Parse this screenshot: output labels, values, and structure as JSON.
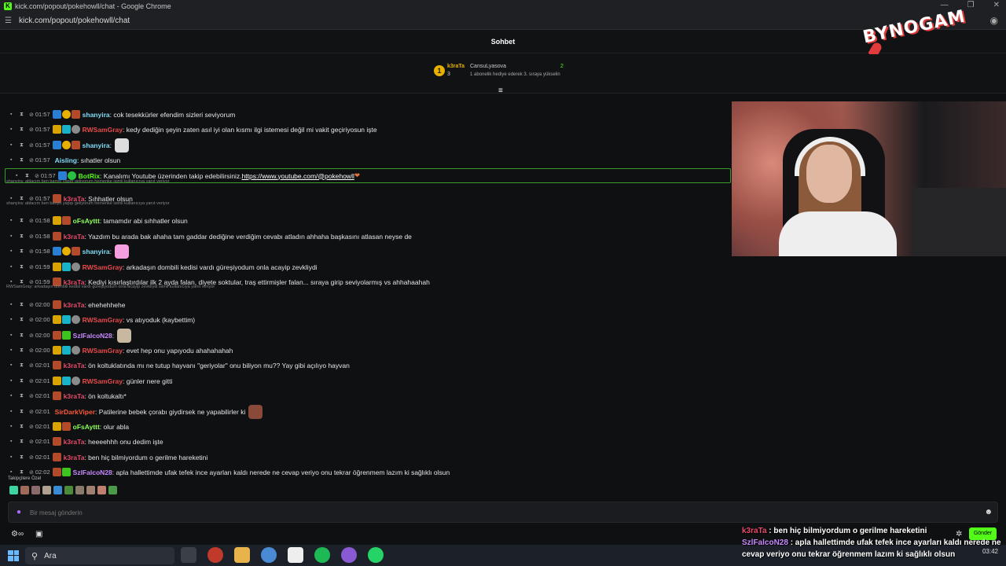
{
  "window": {
    "title": "kick.com/popout/pokehowll/chat - Google Chrome",
    "url": "kick.com/popout/pokehowll/chat"
  },
  "chat": {
    "header": "Sohbet",
    "brand": "BYNOGAM",
    "pinned": {
      "rank": "1",
      "top_user": "k3raTa",
      "top_count": "3",
      "gifter": "CansuLyasova",
      "gift_text": "1 abonelik hediye ederek 3. sıraya yükselin",
      "right_count": "2"
    },
    "replies": [
      "shanyira: ablacım ben banyo yapıp geliyorum hemenke isimli kullanıcıya yanıt veriyor",
      "shanyira: ablacım ben banyo yapıp geliyorum hemenke isimli kullanıcıya yanıt veriyor",
      "RWSamGray: arkadaşın dombili kedisi vardı güreşiyodum onla acayip zevkliydi isimli kullanıcıya yanıt veriyor"
    ],
    "messages": [
      {
        "time": "01:57",
        "user": "shanyira",
        "color": "#7fdcf5",
        "text": ": cok tesekkürler efendim sizleri seviyorum"
      },
      {
        "time": "01:57",
        "user": "RWSamGray",
        "color": "#e84a4a",
        "text": ": kedy dediğin şeyin zaten asıl iyi olan kısmı ilgi istemesi değil mi vakit geçiriyosun işte"
      },
      {
        "time": "01:57",
        "user": "shanyira",
        "color": "#7fdcf5",
        "text": ":"
      },
      {
        "time": "01:57",
        "user": "Aisling",
        "color": "#7fdcf5",
        "text": ": sıhatler olsun"
      },
      {
        "time": "01:57",
        "user": "BotRix",
        "color": "#53fc18",
        "text": ": Kanalımı Youtube üzerinden takip edebilirsiniz. ",
        "link": "https://www.youtube.com/@pokehowll",
        "suffix": " ❤"
      },
      {
        "time": "01:57",
        "user": "k3raTa",
        "color": "#e84a6a",
        "text": ": Sıhhatler olsun"
      },
      {
        "time": "01:58",
        "user": "oFsAyttt",
        "color": "#8cff5a",
        "text": ": tamamdır abi sıhhatler olsun"
      },
      {
        "time": "01:58",
        "user": "k3raTa",
        "color": "#e84a6a",
        "text": ": Yazdım bu arada bak ahaha tam gaddar dediğine verdiğim cevabı atladın ahhaha başkasını atlasan neyse de"
      },
      {
        "time": "01:58",
        "user": "shanyira",
        "color": "#7fdcf5",
        "text": ":"
      },
      {
        "time": "01:59",
        "user": "RWSamGray",
        "color": "#e84a4a",
        "text": ": arkadaşın dombili kedisi vardı güreşiyodum onla acayip zevkliydi"
      },
      {
        "time": "01:59",
        "user": "k3raTa",
        "color": "#e84a6a",
        "text": ": Kediyi kısırlaştırdılar ilk 2 ayda falan, diyete soktular, traş ettirmişler falan... sıraya girip seviyolarmış vs ahhahaahah"
      },
      {
        "time": "02:00",
        "user": "k3raTa",
        "color": "#e84a6a",
        "text": ": ehehehhehe"
      },
      {
        "time": "02:00",
        "user": "RWSamGray",
        "color": "#e84a4a",
        "text": ": vs atıyoduk (kaybettim)"
      },
      {
        "time": "02:00",
        "user": "SzlFalcoN28",
        "color": "#c88aff",
        "text": ":"
      },
      {
        "time": "02:00",
        "user": "RWSamGray",
        "color": "#e84a4a",
        "text": ": evet hep onu yapıyodu ahahahahah"
      },
      {
        "time": "02:01",
        "user": "k3raTa",
        "color": "#e84a6a",
        "text": ": ön koltuklatında mı ne tutup hayvanı \"geriyolar\" onu biliyon mu?? Yay gibi açılıyo hayvan"
      },
      {
        "time": "02:01",
        "user": "RWSamGray",
        "color": "#e84a4a",
        "text": ": günler nere gitti"
      },
      {
        "time": "02:01",
        "user": "k3raTa",
        "color": "#e84a6a",
        "text": ": ön koltukaltı*"
      },
      {
        "time": "02:01",
        "user": "SirDarkViper",
        "color": "#ff5a3a",
        "text": ": Patilerine bebek çorabı giydirsek ne yapabilirler ki"
      },
      {
        "time": "02:01",
        "user": "oFsAyttt",
        "color": "#8cff5a",
        "text": ": olur abla"
      },
      {
        "time": "02:01",
        "user": "k3raTa",
        "color": "#e84a6a",
        "text": ": heeeehhh onu dedim işte"
      },
      {
        "time": "02:01",
        "user": "k3raTa",
        "color": "#e84a6a",
        "text": ": ben hiç bilmiyordum o gerilme hareketini"
      },
      {
        "time": "02:02",
        "user": "SzlFalcoN28",
        "color": "#c88aff",
        "text": ": apla hallettimde ufak tefek ince ayarları kaldı nerede ne cevap veriyo onu tekrar öğrenmem lazım ki sağlıklı olsun"
      }
    ],
    "subs_label": "Takipçilere Özel",
    "input": {
      "placeholder": "Bir mesaj gönderin"
    },
    "send_label": "Gönder"
  },
  "overlay": {
    "line1_user": "k3raTa",
    "line1_text": " : ben hiç bilmiyordum o gerilme hareketini",
    "line2_user": "SzlFalcoN28",
    "line2_text": " : apla hallettimde ufak tefek ince ayarları kaldı nerede ne cevap veriyo onu tekrar öğrenmem lazım ki sağlıklı olsun"
  },
  "taskbar": {
    "search": "Ara",
    "time": "03:42",
    "date": "..."
  }
}
